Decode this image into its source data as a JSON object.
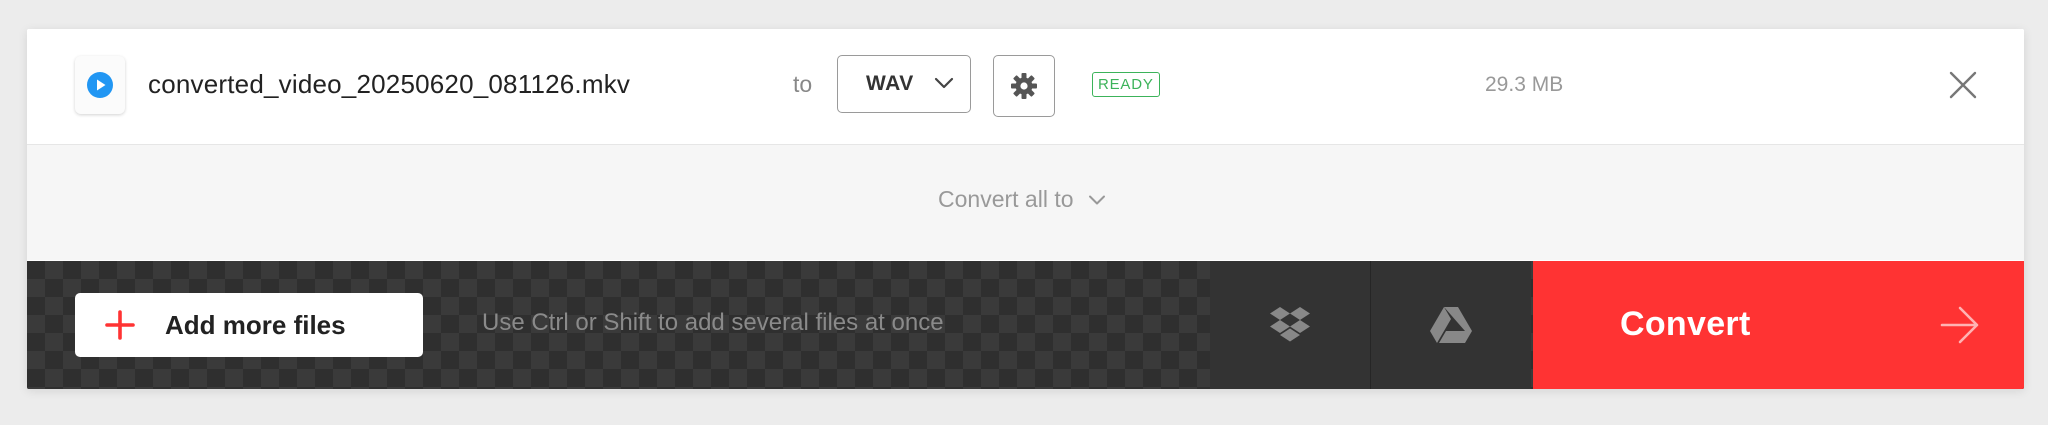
{
  "file": {
    "name": "converted_video_20250620_081126.mkv",
    "to_label": "to",
    "format": "WAV",
    "status": "READY",
    "size": "29.3 MB"
  },
  "convert_all": {
    "label": "Convert all to"
  },
  "bottom_bar": {
    "add_files_label": "Add more files",
    "hint": "Use Ctrl or Shift to add several files at once",
    "convert_label": "Convert"
  },
  "colors": {
    "accent": "#ff3333",
    "status_ready": "#3cb35a",
    "file_icon": "#2196f3"
  },
  "icons": [
    "play-icon",
    "chevron-down-icon",
    "gear-icon",
    "close-icon",
    "plus-icon",
    "dropbox-icon",
    "google-drive-icon",
    "arrow-right-icon"
  ]
}
